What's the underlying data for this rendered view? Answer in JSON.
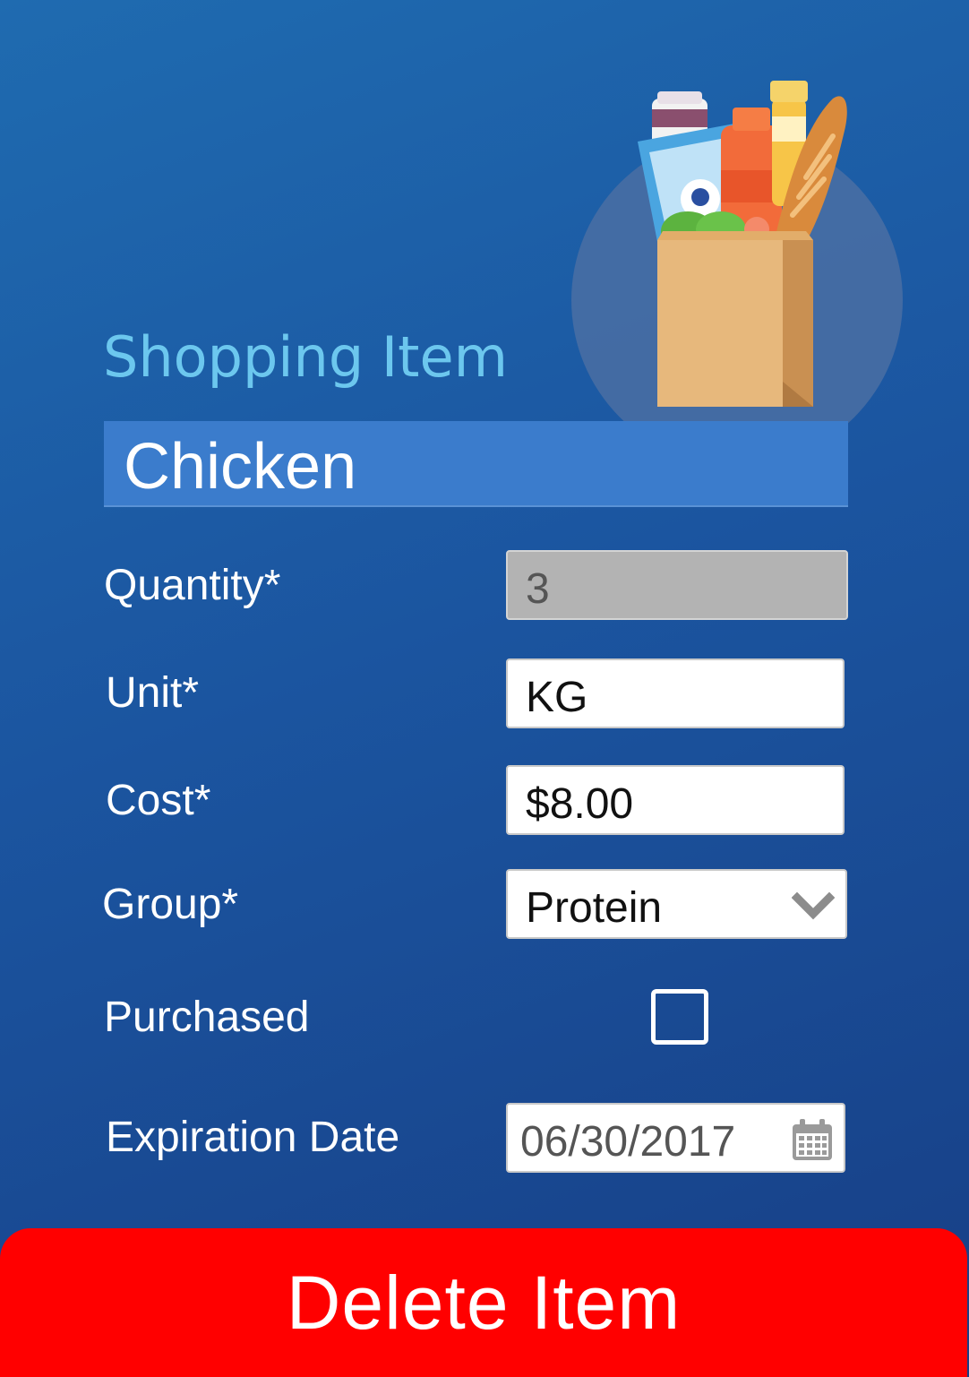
{
  "form": {
    "title": "Shopping Item",
    "item_name": "Chicken",
    "quantity": {
      "label": "Quantity*",
      "value": "3"
    },
    "unit": {
      "label": "Unit*",
      "value": "KG"
    },
    "cost": {
      "label": "Cost*",
      "value": "$8.00"
    },
    "group": {
      "label": "Group*",
      "value": "Protein"
    },
    "purchased": {
      "label": "Purchased",
      "checked": false
    },
    "expiration": {
      "label": "Expiration Date",
      "value": "06/30/2017"
    }
  },
  "actions": {
    "delete_label": "Delete Item"
  },
  "icons": {
    "illustration": "grocery-bag-icon",
    "group_dropdown": "chevron-down-icon",
    "date_picker": "calendar-icon"
  },
  "colors": {
    "background_top": "#1f6bb0",
    "background_bottom": "#173f86",
    "title": "#6cc7ee",
    "name_field": "#3b7ccc",
    "delete_button": "#ff0000"
  }
}
